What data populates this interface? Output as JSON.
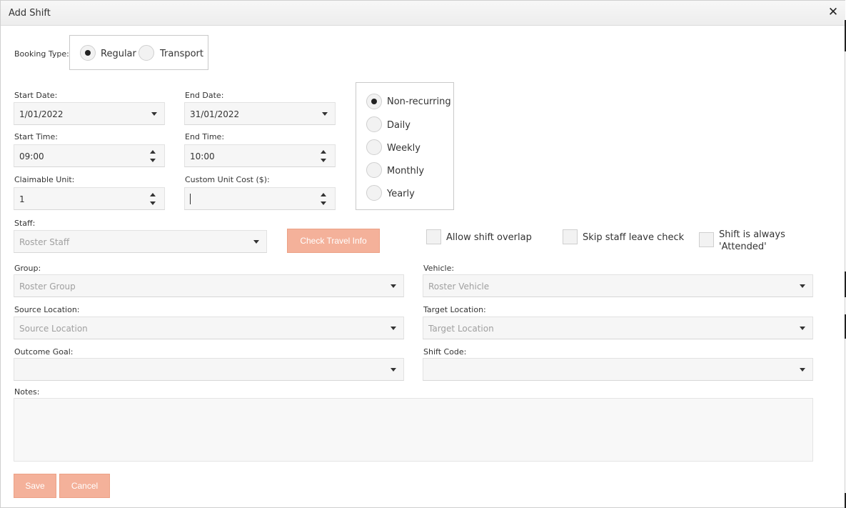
{
  "dialog": {
    "title": "Add Shift",
    "close_glyph": "✕"
  },
  "booking": {
    "label": "Booking Type:",
    "options": [
      "Regular",
      "Transport"
    ],
    "selected": "Regular"
  },
  "dates": {
    "start_label": "Start Date:",
    "start_value": "1/01/2022",
    "end_label": "End Date:",
    "end_value": "31/01/2022"
  },
  "times": {
    "start_label": "Start Time:",
    "start_value": "09:00",
    "end_label": "End Time:",
    "end_value": "10:00"
  },
  "units": {
    "claimable_label": "Claimable Unit:",
    "claimable_value": "1",
    "cost_label": "Custom Unit Cost ($):",
    "cost_value": ""
  },
  "recurrence": {
    "options": [
      "Non-recurring",
      "Daily",
      "Weekly",
      "Monthly",
      "Yearly"
    ],
    "selected": "Non-recurring"
  },
  "staff": {
    "label": "Staff:",
    "placeholder": "Roster Staff",
    "travel_button": "Check Travel Info"
  },
  "checks": {
    "overlap": "Allow shift overlap",
    "leave": "Skip staff leave check",
    "attended_line1": "Shift is always",
    "attended_line2": "'Attended'"
  },
  "group": {
    "label": "Group:",
    "placeholder": "Roster Group"
  },
  "vehicle": {
    "label": "Vehicle:",
    "placeholder": "Roster Vehicle"
  },
  "source": {
    "label": "Source Location:",
    "placeholder": "Source Location"
  },
  "target": {
    "label": "Target Location:",
    "placeholder": "Target Location"
  },
  "outcome": {
    "label": "Outcome Goal:",
    "value": ""
  },
  "shift_code": {
    "label": "Shift Code:",
    "value": ""
  },
  "notes": {
    "label": "Notes:",
    "value": ""
  },
  "actions": {
    "save": "Save",
    "cancel": "Cancel"
  },
  "colors": {
    "accent_button": "#f4b19a",
    "field_bg": "#f6f6f6"
  }
}
